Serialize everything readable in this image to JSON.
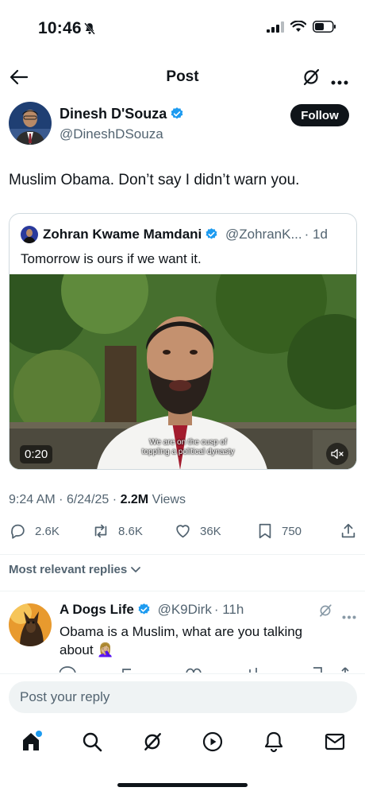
{
  "status_bar": {
    "time": "10:46"
  },
  "header": {
    "title": "Post"
  },
  "post": {
    "author_name": "Dinesh D'Souza",
    "author_handle": "@DineshDSouza",
    "follow_label": "Follow",
    "text": "Muslim Obama. Don’t say I didn’t warn you.",
    "time": "9:24 AM",
    "date": "6/24/25",
    "views_count": "2.2M",
    "views_label": "Views",
    "separator": "·"
  },
  "quote": {
    "author_name": "Zohran Kwame Mamdani",
    "author_handle": "@ZohranK...",
    "age": "· 1d",
    "text": "Tomorrow is ours if we want it.",
    "video": {
      "duration": "0:20",
      "caption_line1": "We are on the cusp of",
      "caption_line2": "toppling a political dynasty"
    }
  },
  "actions": {
    "replies": "2.6K",
    "reposts": "8.6K",
    "likes": "36K",
    "bookmarks": "750"
  },
  "replies_filter": {
    "label": "Most relevant replies"
  },
  "reply": {
    "author_name": "A Dogs Life",
    "author_handle": "@K9Dirk",
    "age": "· 11h",
    "text_line1": "Obama is a Muslim, what are you talking",
    "text_line2": "about",
    "emoji": "🤦🏼‍♀️"
  },
  "reply_composer": {
    "placeholder": "Post your reply"
  },
  "tab_bar": {
    "items": [
      "home-icon",
      "search-icon",
      "grok-icon",
      "play-icon",
      "notifications-icon",
      "messages-icon"
    ]
  },
  "colors": {
    "accent": "#1d9bf0",
    "text": "#0f1419",
    "muted": "#536471",
    "border": "#cfd9de"
  }
}
